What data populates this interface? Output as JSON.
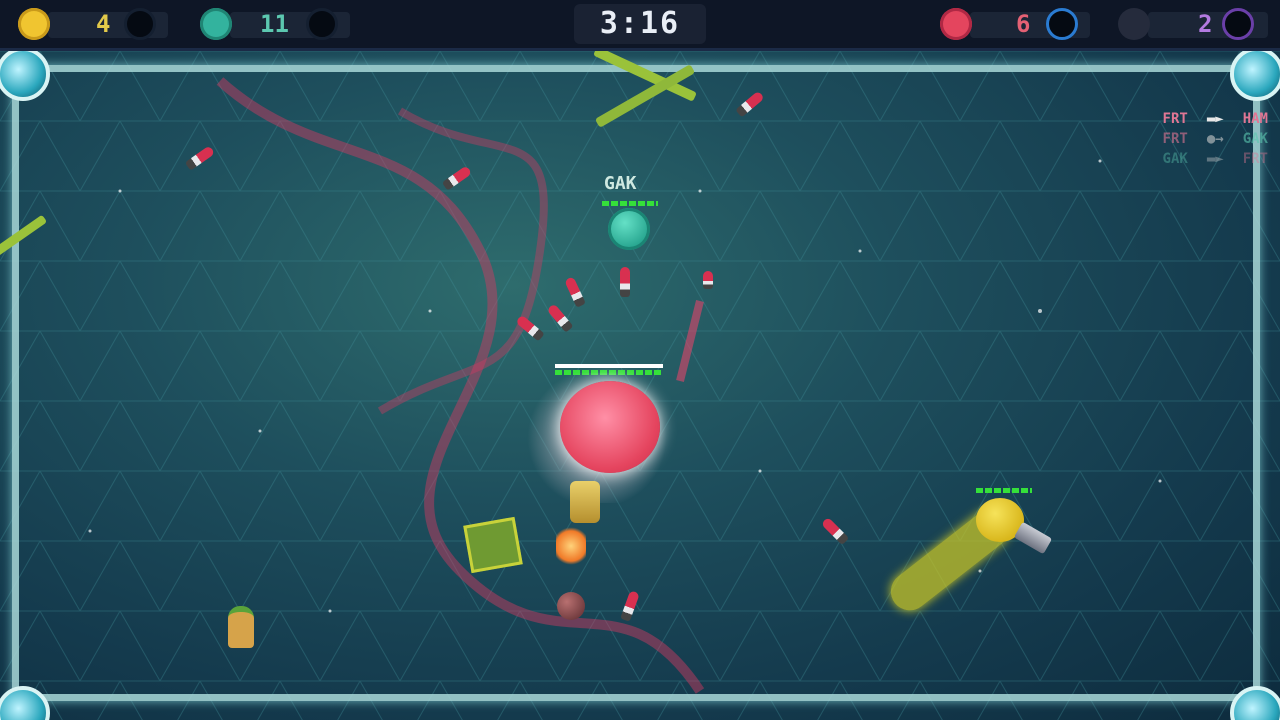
{
  "hud": {
    "timer": "3:16",
    "players": [
      {
        "score": "4",
        "color": "#f0c530",
        "score_color": "#e2c94a"
      },
      {
        "score": "11",
        "color": "#33b39e",
        "score_color": "#5cc8b0"
      },
      {
        "score": "6",
        "color": "#e4455e",
        "score_color": "#e46174"
      },
      {
        "score": "2",
        "color": "#252b3c",
        "score_color": "#b37ae0"
      }
    ]
  },
  "killfeed": [
    {
      "killer": "FRT",
      "victim": "HAM",
      "killer_color": "#e07694",
      "victim_color": "#e07694",
      "weapon_icon": "rifle-icon"
    },
    {
      "killer": "FRT",
      "victim": "GAK",
      "killer_color": "#e07694",
      "victim_color": "#5cc8b0",
      "weapon_icon": "bomb-icon"
    },
    {
      "killer": "GAK",
      "victim": "FRT",
      "killer_color": "#5cc8b0",
      "victim_color": "#e07694",
      "weapon_icon": "rifle-icon"
    }
  ],
  "arena": {
    "nametag": "GAK"
  },
  "colors": {
    "frame": "#a8d8d8",
    "health": "#35e03a"
  }
}
